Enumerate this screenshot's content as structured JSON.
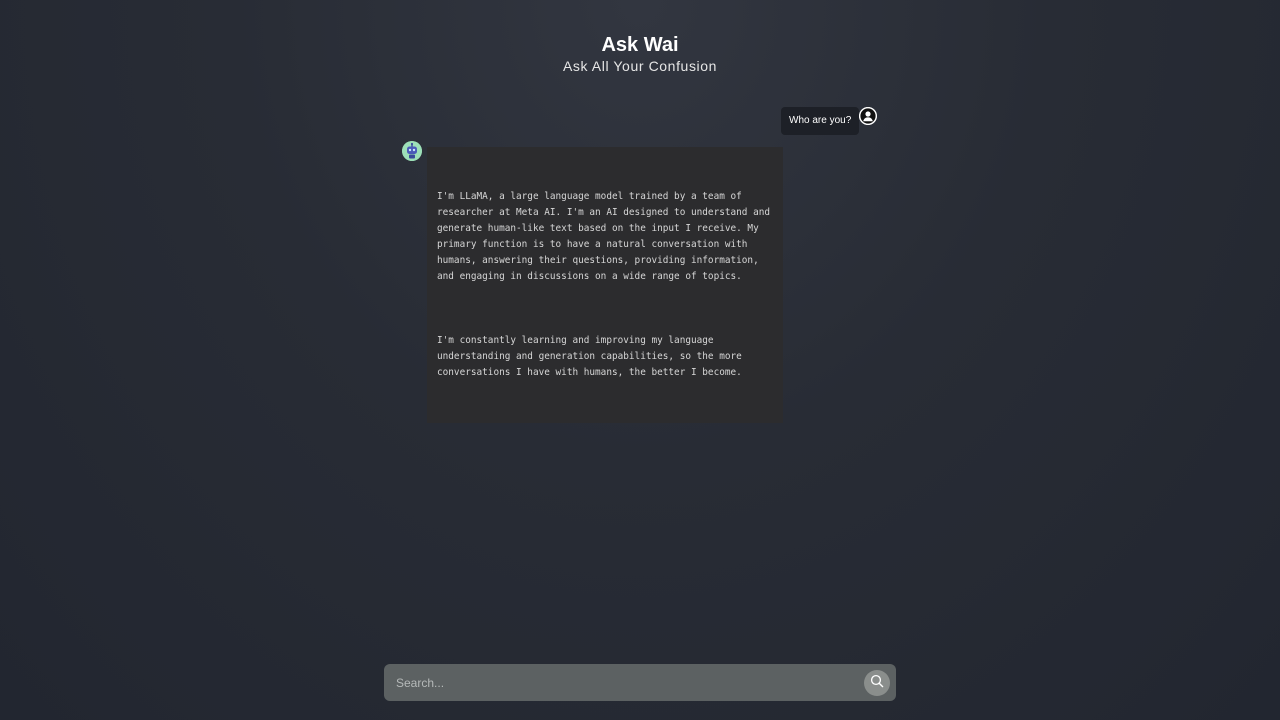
{
  "header": {
    "title": "Ask Wai",
    "subtitle": "Ask All Your Confusion"
  },
  "messages": [
    {
      "role": "user",
      "text": "Who are you?",
      "avatar_icon": "user-icon"
    },
    {
      "role": "assistant",
      "avatar_icon": "robot-icon",
      "paragraphs": [
        "I'm LLaMA, a large language model trained by a team of researcher at Meta AI. I'm an AI designed to understand and generate human-like text based on the input I receive. My primary function is to have a natural conversation with humans, answering their questions, providing information, and engaging in discussions on a wide range of topics.",
        "I'm constantly learning and improving my language understanding and generation capabilities, so the more conversations I have with humans, the better I become."
      ]
    }
  ],
  "search": {
    "placeholder": "Search...",
    "value": "",
    "button_icon": "search-icon"
  },
  "colors": {
    "background": "#282c35",
    "user_bubble": "#1d2027",
    "bot_bubble": "#2c2c2e",
    "search_bar": "#5c6162",
    "search_button": "#8a8e8c",
    "bot_avatar": "#9de0b8"
  }
}
